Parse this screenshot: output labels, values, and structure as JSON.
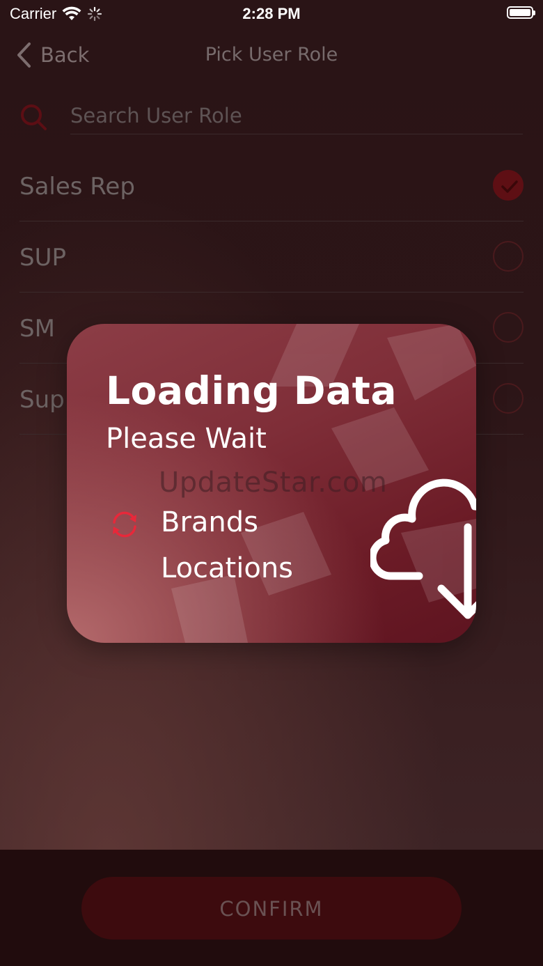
{
  "status_bar": {
    "carrier": "Carrier",
    "time": "2:28 PM"
  },
  "nav": {
    "back_label": "Back",
    "title": "Pick User Role"
  },
  "search": {
    "placeholder": "Search User Role"
  },
  "roles": [
    {
      "label": "Sales Rep",
      "selected": true
    },
    {
      "label": "SUP",
      "selected": false
    },
    {
      "label": "SM",
      "selected": false
    },
    {
      "label": "Sup",
      "selected": false
    }
  ],
  "loading": {
    "title": "Loading Data",
    "subtitle": "Please Wait",
    "watermark": "UpdateStar.com",
    "tasks": [
      {
        "label": "Brands",
        "status": "in-progress"
      },
      {
        "label": "Locations",
        "status": "pending"
      }
    ]
  },
  "footer": {
    "confirm_label": "CONFIRM"
  },
  "colors": {
    "accent": "#c8102e",
    "card_top": "#8c3d46",
    "card_bottom": "#5e1420",
    "confirm_bg": "#3d0b0e"
  }
}
